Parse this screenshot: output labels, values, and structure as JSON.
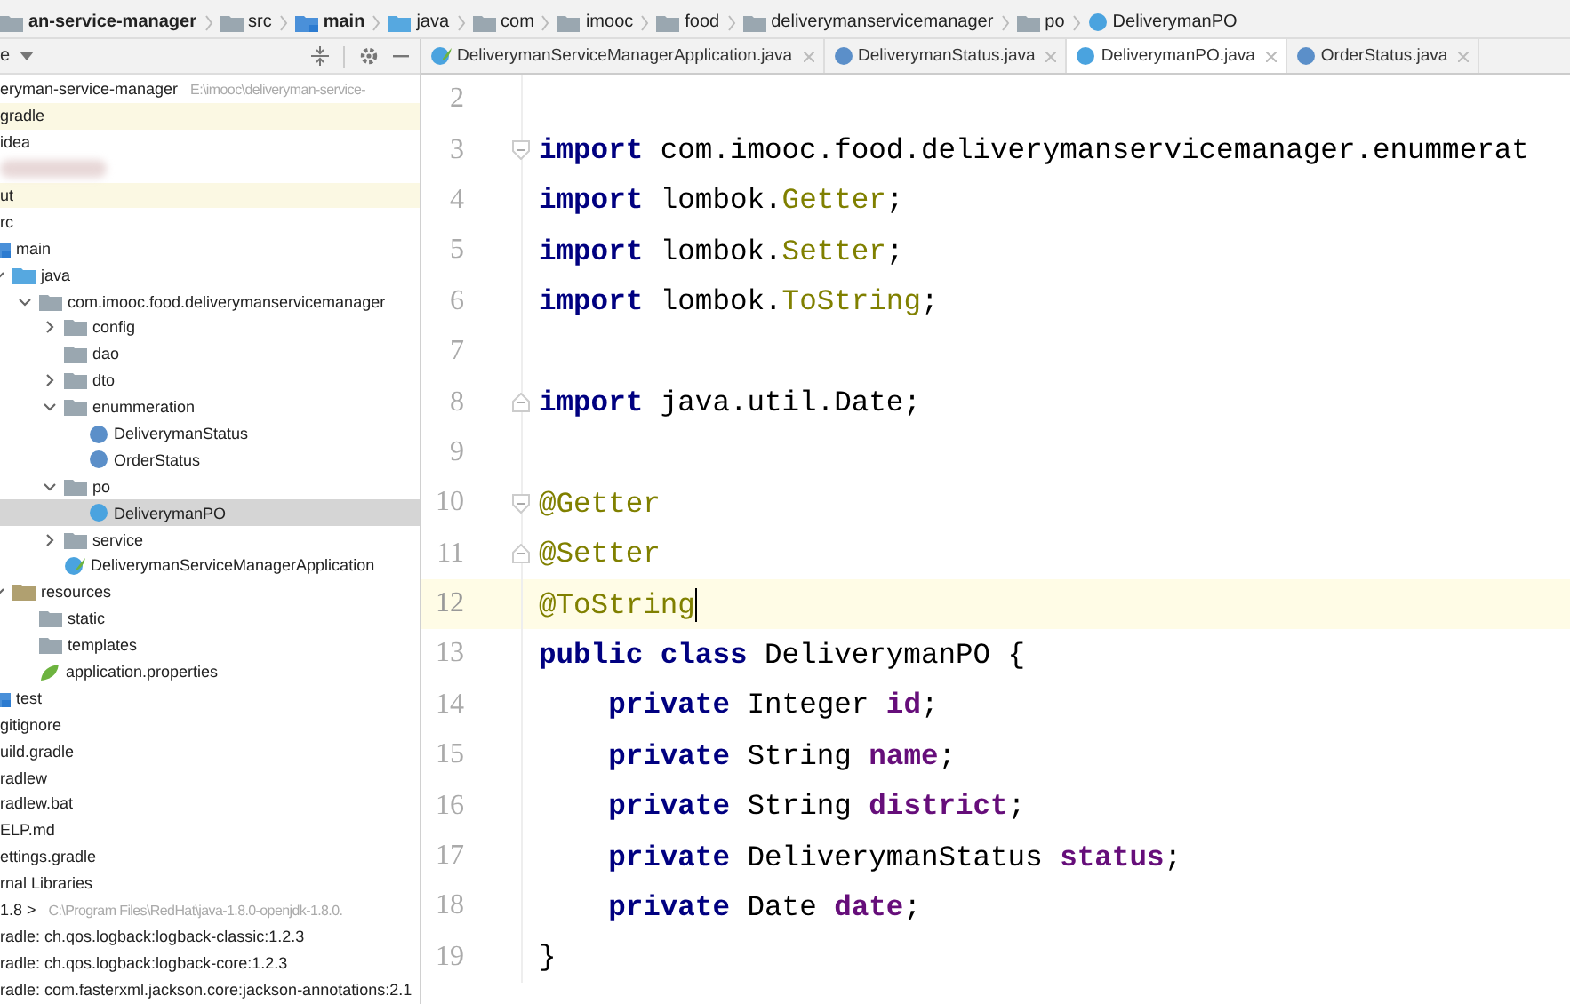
{
  "breadcrumb": [
    {
      "label": "an-service-manager",
      "kind": "module",
      "bold": true
    },
    {
      "label": "src",
      "kind": "folder",
      "bold": false
    },
    {
      "label": "main",
      "kind": "source",
      "bold": true
    },
    {
      "label": "java",
      "kind": "java",
      "bold": false
    },
    {
      "label": "com",
      "kind": "folder",
      "bold": false
    },
    {
      "label": "imooc",
      "kind": "folder",
      "bold": false
    },
    {
      "label": "food",
      "kind": "folder",
      "bold": false
    },
    {
      "label": "deliverymanservicemanager",
      "kind": "folder",
      "bold": false
    },
    {
      "label": "po",
      "kind": "folder",
      "bold": false
    },
    {
      "label": "DeliverymanPO",
      "kind": "class",
      "bold": false
    }
  ],
  "panel": {
    "title": "e"
  },
  "tabs": [
    {
      "label": "DeliverymanServiceManagerApplication.java",
      "kind": "app",
      "selected": false
    },
    {
      "label": "DeliverymanStatus.java",
      "kind": "enum",
      "selected": false
    },
    {
      "label": "DeliverymanPO.java",
      "kind": "class",
      "selected": true
    },
    {
      "label": "OrderStatus.java",
      "kind": "enum",
      "selected": false
    }
  ],
  "tree": [
    {
      "label": "eryman-service-manager",
      "path": "E:\\imooc\\deliveryman-service-",
      "selected": false,
      "children": [
        {
          "label": "gradle",
          "selected": false,
          "excluded": true
        },
        {
          "label": "idea",
          "selected": false,
          "excluded": false
        },
        {
          "kind": "blurred",
          "selected": false,
          "excluded": false
        },
        {
          "label": "ut",
          "selected": false,
          "excluded": true
        },
        {
          "label": "rc",
          "selected": false,
          "excluded": false,
          "children": [
            {
              "label": "main",
              "kind": "source",
              "selected": false,
              "children": [
                {
                  "label": "java",
                  "kind": "java",
                  "selected": false,
                  "expanded": true,
                  "children": [
                    {
                      "label": "com.imooc.food.deliverymanservicemanager",
                      "kind": "folder",
                      "selected": false,
                      "expanded": true,
                      "children": [
                        {
                          "label": "config",
                          "kind": "folder",
                          "selected": false,
                          "expanded": false
                        },
                        {
                          "label": "dao",
                          "kind": "folder",
                          "selected": false
                        },
                        {
                          "label": "dto",
                          "kind": "folder",
                          "selected": false,
                          "expanded": false
                        },
                        {
                          "label": "enummeration",
                          "kind": "folder",
                          "selected": false,
                          "expanded": true,
                          "children": [
                            {
                              "label": "DeliverymanStatus",
                              "kind": "enum",
                              "selected": false
                            },
                            {
                              "label": "OrderStatus",
                              "kind": "enum",
                              "selected": false
                            }
                          ]
                        },
                        {
                          "label": "po",
                          "kind": "folder",
                          "selected": false,
                          "expanded": true,
                          "children": [
                            {
                              "label": "DeliverymanPO",
                              "kind": "class",
                              "selected": true
                            }
                          ]
                        },
                        {
                          "label": "service",
                          "kind": "folder",
                          "selected": false,
                          "expanded": false
                        },
                        {
                          "label": "DeliverymanServiceManagerApplication",
                          "kind": "app",
                          "selected": false
                        }
                      ]
                    }
                  ]
                },
                {
                  "label": "resources",
                  "kind": "resources",
                  "selected": false,
                  "expanded": true,
                  "children": [
                    {
                      "label": "static",
                      "kind": "folder",
                      "selected": false
                    },
                    {
                      "label": "templates",
                      "kind": "folder",
                      "selected": false
                    },
                    {
                      "label": "application.properties",
                      "kind": "properties",
                      "selected": false
                    }
                  ]
                }
              ]
            },
            {
              "label": "test",
              "kind": "source",
              "selected": false
            }
          ]
        },
        {
          "label": "gitignore",
          "selected": false,
          "excluded": false
        },
        {
          "label": "uild.gradle",
          "selected": false,
          "excluded": false
        },
        {
          "label": "radlew",
          "selected": false,
          "excluded": false
        },
        {
          "label": "radlew.bat",
          "selected": false,
          "excluded": false
        },
        {
          "label": "ELP.md",
          "selected": false,
          "excluded": false
        },
        {
          "label": "ettings.gradle",
          "selected": false,
          "excluded": false
        }
      ]
    },
    {
      "label": "rnal Libraries",
      "selected": false,
      "children": [
        {
          "label": "1.8 >",
          "path": "C:\\Program Files\\RedHat\\java-1.8.0-openjdk-1.8.0.",
          "selected": false
        },
        {
          "label": "radle: ch.qos.logback:logback-classic:1.2.3",
          "selected": false
        },
        {
          "label": "radle: ch.qos.logback:logback-core:1.2.3",
          "selected": false
        },
        {
          "label": "radle: com.fasterxml.jackson.core:jackson-annotations:2.1",
          "selected": false
        }
      ]
    }
  ],
  "code": [
    {
      "number": "2",
      "current": false,
      "fold_start": false,
      "fold_end": false
    },
    {
      "number": "3",
      "current": false,
      "fold_start": true,
      "fold_end": false,
      "tokens": [
        {
          "kind": "keyword",
          "text": "import"
        },
        {
          "kind": "plain",
          "text": " com.imooc.food.deliverymanservicemanager.enummerat"
        }
      ]
    },
    {
      "number": "4",
      "current": false,
      "fold_start": false,
      "fold_end": false,
      "tokens": [
        {
          "kind": "keyword",
          "text": "import"
        },
        {
          "kind": "plain",
          "text": " lombok."
        },
        {
          "kind": "annotation",
          "text": "Getter"
        },
        {
          "kind": "plain",
          "text": ";"
        }
      ]
    },
    {
      "number": "5",
      "current": false,
      "fold_start": false,
      "fold_end": false,
      "tokens": [
        {
          "kind": "keyword",
          "text": "import"
        },
        {
          "kind": "plain",
          "text": " lombok."
        },
        {
          "kind": "annotation",
          "text": "Setter"
        },
        {
          "kind": "plain",
          "text": ";"
        }
      ]
    },
    {
      "number": "6",
      "current": false,
      "fold_start": false,
      "fold_end": false,
      "tokens": [
        {
          "kind": "keyword",
          "text": "import"
        },
        {
          "kind": "plain",
          "text": " lombok."
        },
        {
          "kind": "annotation",
          "text": "ToString"
        },
        {
          "kind": "plain",
          "text": ";"
        }
      ]
    },
    {
      "number": "7",
      "current": false,
      "fold_start": false,
      "fold_end": false
    },
    {
      "number": "8",
      "current": false,
      "fold_start": false,
      "fold_end": true,
      "tokens": [
        {
          "kind": "keyword",
          "text": "import"
        },
        {
          "kind": "plain",
          "text": " java.util.Date;"
        }
      ]
    },
    {
      "number": "9",
      "current": false,
      "fold_start": false,
      "fold_end": false
    },
    {
      "number": "10",
      "current": false,
      "fold_start": true,
      "fold_end": false,
      "tokens": [
        {
          "kind": "annotation",
          "text": "@Getter"
        }
      ]
    },
    {
      "number": "11",
      "current": false,
      "fold_start": false,
      "fold_end": true,
      "tokens": [
        {
          "kind": "annotation",
          "text": "@Setter"
        }
      ]
    },
    {
      "number": "12",
      "current": true,
      "fold_start": false,
      "fold_end": false,
      "tokens": [
        {
          "kind": "annotation",
          "text": "@ToString"
        }
      ]
    },
    {
      "number": "13",
      "current": false,
      "fold_start": false,
      "fold_end": false,
      "tokens": [
        {
          "kind": "keyword",
          "text": "public class"
        },
        {
          "kind": "plain",
          "text": " DeliverymanPO {"
        }
      ]
    },
    {
      "number": "14",
      "current": false,
      "fold_start": false,
      "fold_end": false,
      "tokens": [
        {
          "kind": "keyword",
          "text": "    private"
        },
        {
          "kind": "plain",
          "text": " Integer "
        },
        {
          "kind": "field",
          "text": "id"
        },
        {
          "kind": "plain",
          "text": ";"
        }
      ]
    },
    {
      "number": "15",
      "current": false,
      "fold_start": false,
      "fold_end": false,
      "tokens": [
        {
          "kind": "keyword",
          "text": "    private"
        },
        {
          "kind": "plain",
          "text": " String "
        },
        {
          "kind": "field",
          "text": "name"
        },
        {
          "kind": "plain",
          "text": ";"
        }
      ]
    },
    {
      "number": "16",
      "current": false,
      "fold_start": false,
      "fold_end": false,
      "tokens": [
        {
          "kind": "keyword",
          "text": "    private"
        },
        {
          "kind": "plain",
          "text": " String "
        },
        {
          "kind": "field",
          "text": "district"
        },
        {
          "kind": "plain",
          "text": ";"
        }
      ]
    },
    {
      "number": "17",
      "current": false,
      "fold_start": false,
      "fold_end": false,
      "tokens": [
        {
          "kind": "keyword",
          "text": "    private"
        },
        {
          "kind": "plain",
          "text": " DeliverymanStatus "
        },
        {
          "kind": "field",
          "text": "status"
        },
        {
          "kind": "plain",
          "text": ";"
        }
      ]
    },
    {
      "number": "18",
      "current": false,
      "fold_start": false,
      "fold_end": false,
      "tokens": [
        {
          "kind": "keyword",
          "text": "    private"
        },
        {
          "kind": "plain",
          "text": " Date "
        },
        {
          "kind": "field",
          "text": "date"
        },
        {
          "kind": "plain",
          "text": ";"
        }
      ]
    },
    {
      "number": "19",
      "current": false,
      "fold_start": false,
      "fold_end": false,
      "tokens": [
        {
          "kind": "plain",
          "text": "}"
        }
      ]
    }
  ]
}
